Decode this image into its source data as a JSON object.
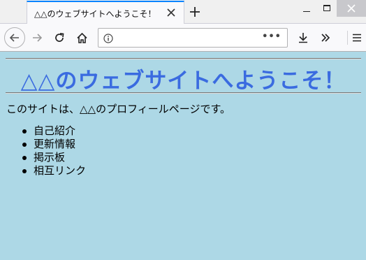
{
  "browser": {
    "tab_title": "△△のウェブサイトへようこそ！",
    "url_placeholder": ""
  },
  "page": {
    "heading": "△△のウェブサイトへようこそ！",
    "intro": "このサイトは、△△のプロフィールページです。",
    "menu_items": [
      "自己紹介",
      "更新情報",
      "掲示板",
      "相互リンク"
    ]
  },
  "colors": {
    "page_background": "#add8e6",
    "heading_color": "#3a6be0",
    "tab_accent": "#0a84ff"
  },
  "icons": [
    "back-arrow-icon",
    "forward-arrow-icon",
    "reload-icon",
    "home-icon",
    "info-icon",
    "page-actions-icon",
    "download-icon",
    "overflow-chevrons-icon",
    "hamburger-menu-icon",
    "close-icon",
    "plus-icon",
    "minimize-icon",
    "maximize-icon"
  ]
}
